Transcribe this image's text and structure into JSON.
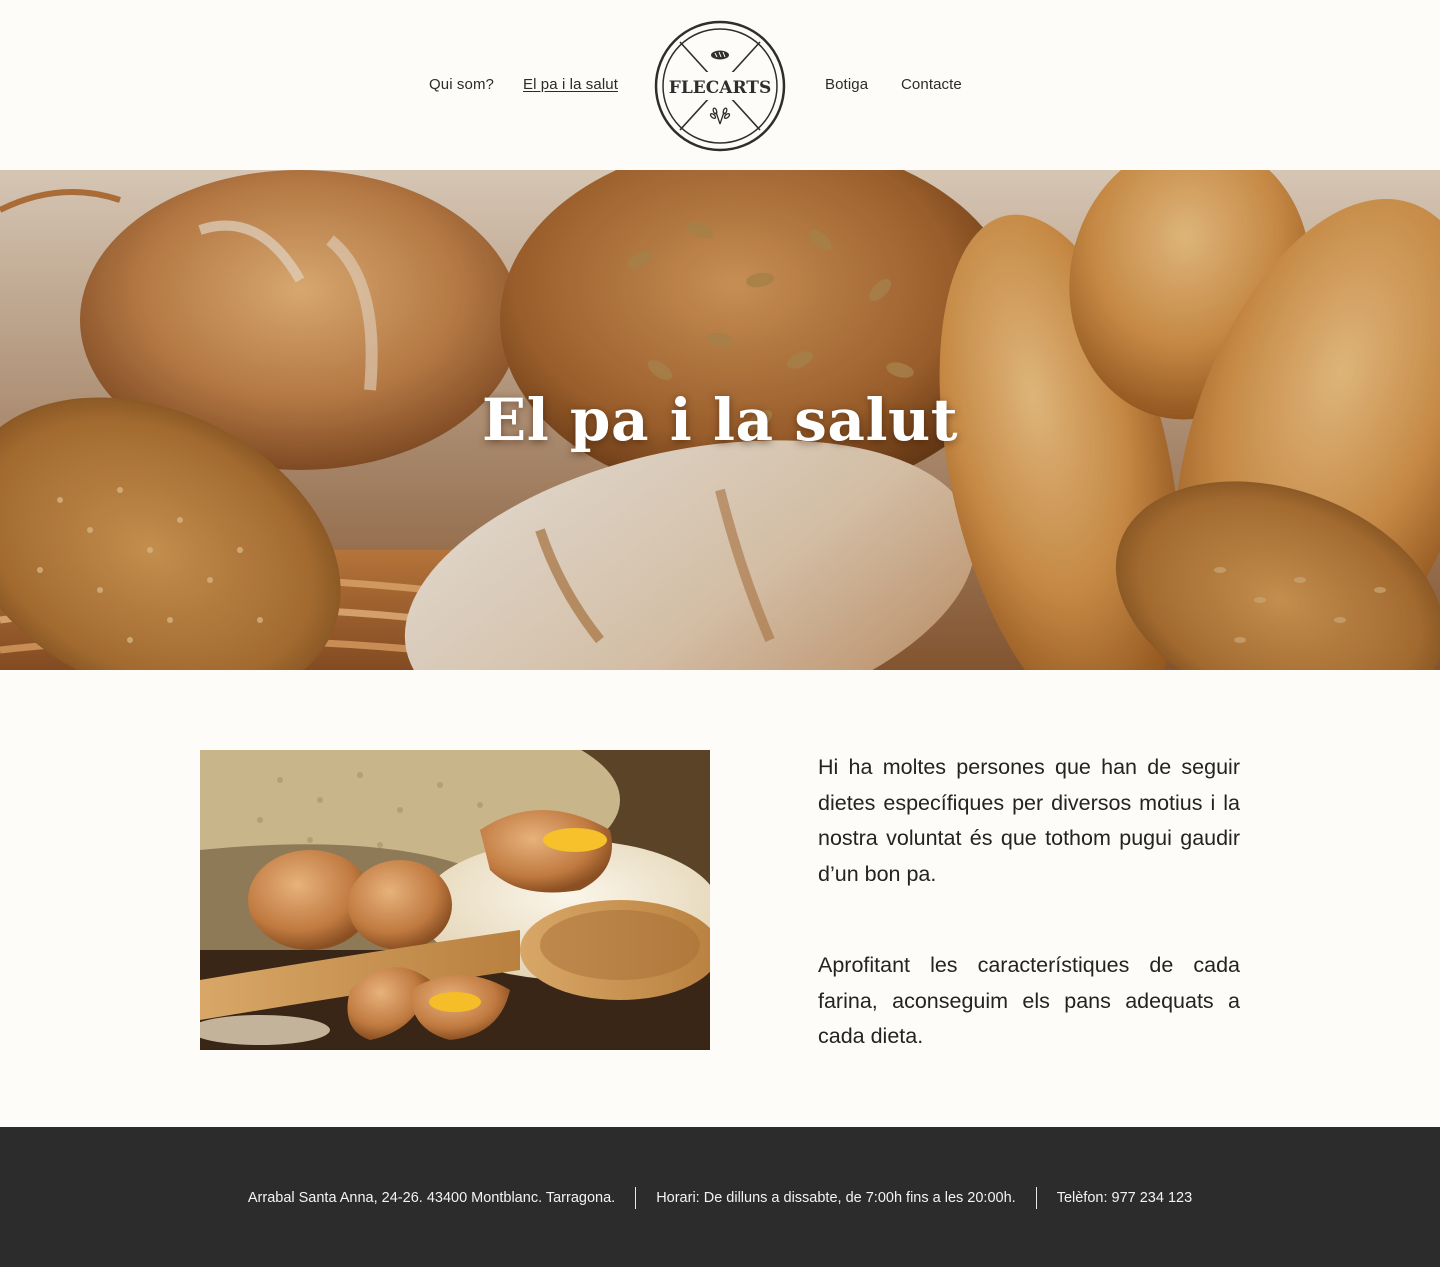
{
  "nav": {
    "items": [
      {
        "label": "Qui som?"
      },
      {
        "label": "El pa i la salut",
        "active": true
      },
      {
        "label": "Botiga"
      },
      {
        "label": "Contacte"
      }
    ]
  },
  "logo": {
    "text": "FLECARTS",
    "icon_top": "bread-icon",
    "icon_bottom": "wheat-icon"
  },
  "hero": {
    "title": "El pa i la salut"
  },
  "content": {
    "paragraphs": [
      "Hi ha moltes persones que han de seguir dietes específiques per diversos motius i la nostra voluntat és que tothom pugui gaudir d’un bon pa.",
      "Aprofitant les característiques de cada farina, aconseguim els pans adequats a cada dieta."
    ]
  },
  "footer": {
    "address": "Arrabal Santa Anna, 24-26. 43400 Montblanc. Tarragona.",
    "hours": "Horari: De dilluns a dissabte, de 7:00h fins a les 20:00h.",
    "phone": "Telèfon: 977 234 123"
  },
  "colors": {
    "background": "#fdfcf8",
    "footer_bg": "#2c2c2c",
    "text": "#2b2b2b",
    "footer_text": "#f3f3f3"
  }
}
